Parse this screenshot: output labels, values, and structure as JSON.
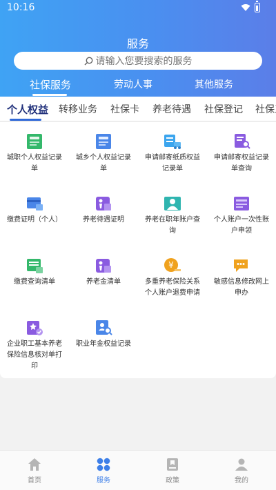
{
  "status_bar": {
    "time": "10:16"
  },
  "header": {
    "title": "服务",
    "search_placeholder": "请输入您要搜索的服务",
    "category_tabs": [
      "社保服务",
      "劳动人事",
      "其他服务"
    ]
  },
  "sub_tabs": [
    "个人权益",
    "转移业务",
    "社保卡",
    "养老待遇",
    "社保登记",
    "社保卫"
  ],
  "services": [
    {
      "label": "城职个人权益记录单",
      "icon": "record-book-icon"
    },
    {
      "label": "城乡个人权益记录单",
      "icon": "record-book-icon"
    },
    {
      "label": "申请邮寄纸质权益记录单",
      "icon": "mail-truck-icon"
    },
    {
      "label": "申请邮寄权益记录单查询",
      "icon": "document-search-icon"
    },
    {
      "label": "缴费证明（个人）",
      "icon": "payment-card-icon"
    },
    {
      "label": "养老待遇证明",
      "icon": "elderly-certificate-icon"
    },
    {
      "label": "养老在职年账户查询",
      "icon": "account-person-icon"
    },
    {
      "label": "个人账户一次性账户申领",
      "icon": "one-time-account-icon"
    },
    {
      "label": "缴费查询清单",
      "icon": "payment-list-icon"
    },
    {
      "label": "养老金清单",
      "icon": "elderly-list-icon"
    },
    {
      "label": "多重养老保险关系个人账户退费申请",
      "icon": "yuan-refund-icon"
    },
    {
      "label": "敏感信息修改网上申办",
      "icon": "message-edit-icon"
    },
    {
      "label": "企业职工基本养老保险信息核对单打印",
      "icon": "verify-print-icon"
    },
    {
      "label": "职业年金权益记录",
      "icon": "annuity-search-icon"
    }
  ],
  "bottom_nav": [
    {
      "label": "首页",
      "icon": "home-icon"
    },
    {
      "label": "服务",
      "icon": "services-grid-icon"
    },
    {
      "label": "政策",
      "icon": "policy-icon"
    },
    {
      "label": "我的",
      "icon": "profile-icon"
    }
  ],
  "colors": {
    "accent": "#3d7fe8",
    "header_start": "#3fa3f4",
    "header_end": "#5b7ee8"
  }
}
